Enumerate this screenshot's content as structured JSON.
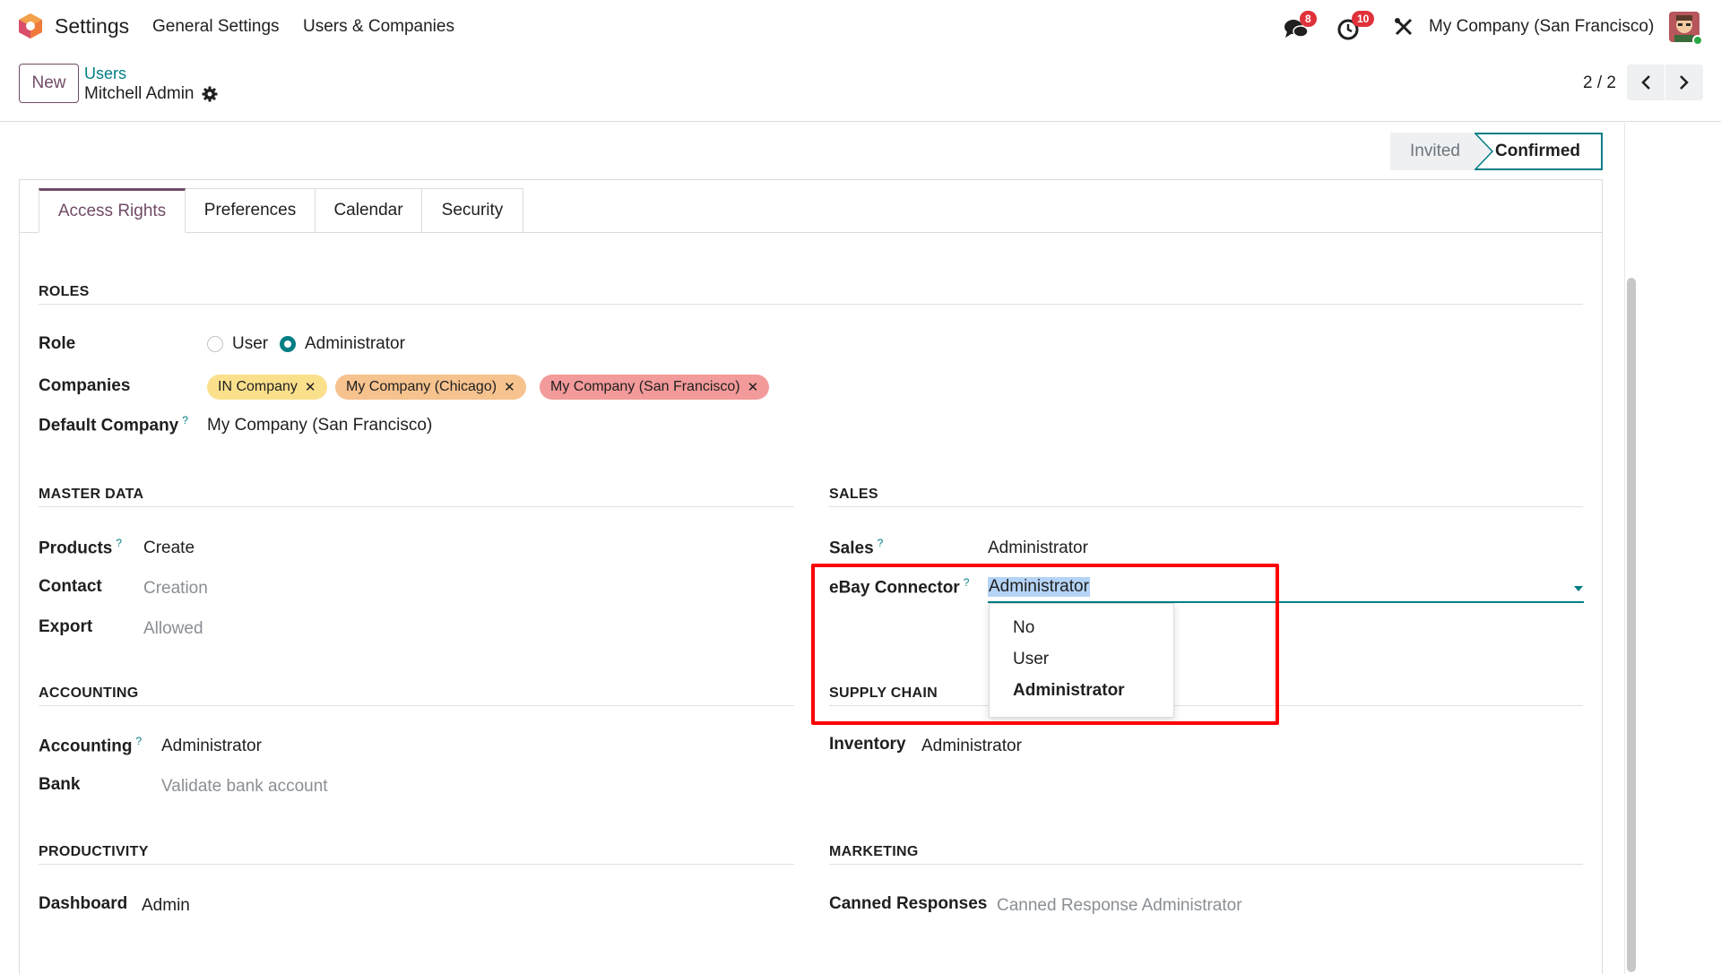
{
  "navbar": {
    "app_title": "Settings",
    "menu": [
      "General Settings",
      "Users & Companies"
    ],
    "chat_badge": "8",
    "activity_badge": "10",
    "company": "My Company (San Francisco)"
  },
  "control": {
    "new_label": "New",
    "breadcrumb_parent": "Users",
    "breadcrumb_current": "Mitchell Admin",
    "pager": "2 / 2"
  },
  "status": {
    "invited": "Invited",
    "confirmed": "Confirmed"
  },
  "tabs": [
    "Access Rights",
    "Preferences",
    "Calendar",
    "Security"
  ],
  "roles": {
    "header": "ROLES",
    "role_label": "Role",
    "role_options": [
      "User",
      "Administrator"
    ],
    "companies_label": "Companies",
    "companies": [
      "IN Company",
      "My Company (Chicago)",
      "My Company (San Francisco)"
    ],
    "default_company_label": "Default Company",
    "default_company": "My Company (San Francisco)"
  },
  "master_data": {
    "header": "MASTER DATA",
    "products_label": "Products",
    "products": "Create",
    "contact_label": "Contact",
    "contact": "Creation",
    "export_label": "Export",
    "export": "Allowed"
  },
  "sales": {
    "header": "SALES",
    "sales_label": "Sales",
    "sales": "Administrator",
    "ebay_label": "eBay Connector",
    "ebay": "Administrator",
    "ebay_options": [
      "No",
      "User",
      "Administrator"
    ]
  },
  "accounting": {
    "header": "ACCOUNTING",
    "accounting_label": "Accounting",
    "accounting": "Administrator",
    "bank_label": "Bank",
    "bank": "Validate bank account"
  },
  "supply_chain": {
    "header": "SUPPLY CHAIN",
    "inventory_label": "Inventory",
    "inventory": "Administrator"
  },
  "productivity": {
    "header": "PRODUCTIVITY",
    "dashboard_label": "Dashboard",
    "dashboard": "Admin"
  },
  "marketing": {
    "header": "MARKETING",
    "canned_label": "Canned Responses",
    "canned": "Canned Response Administrator"
  },
  "help_mark": "?",
  "colors": {
    "brand": "#714b67",
    "accent": "#017e84",
    "tag_yellow": "#fbe08c",
    "tag_orange": "#f6c28e",
    "tag_red": "#f39a9a"
  }
}
